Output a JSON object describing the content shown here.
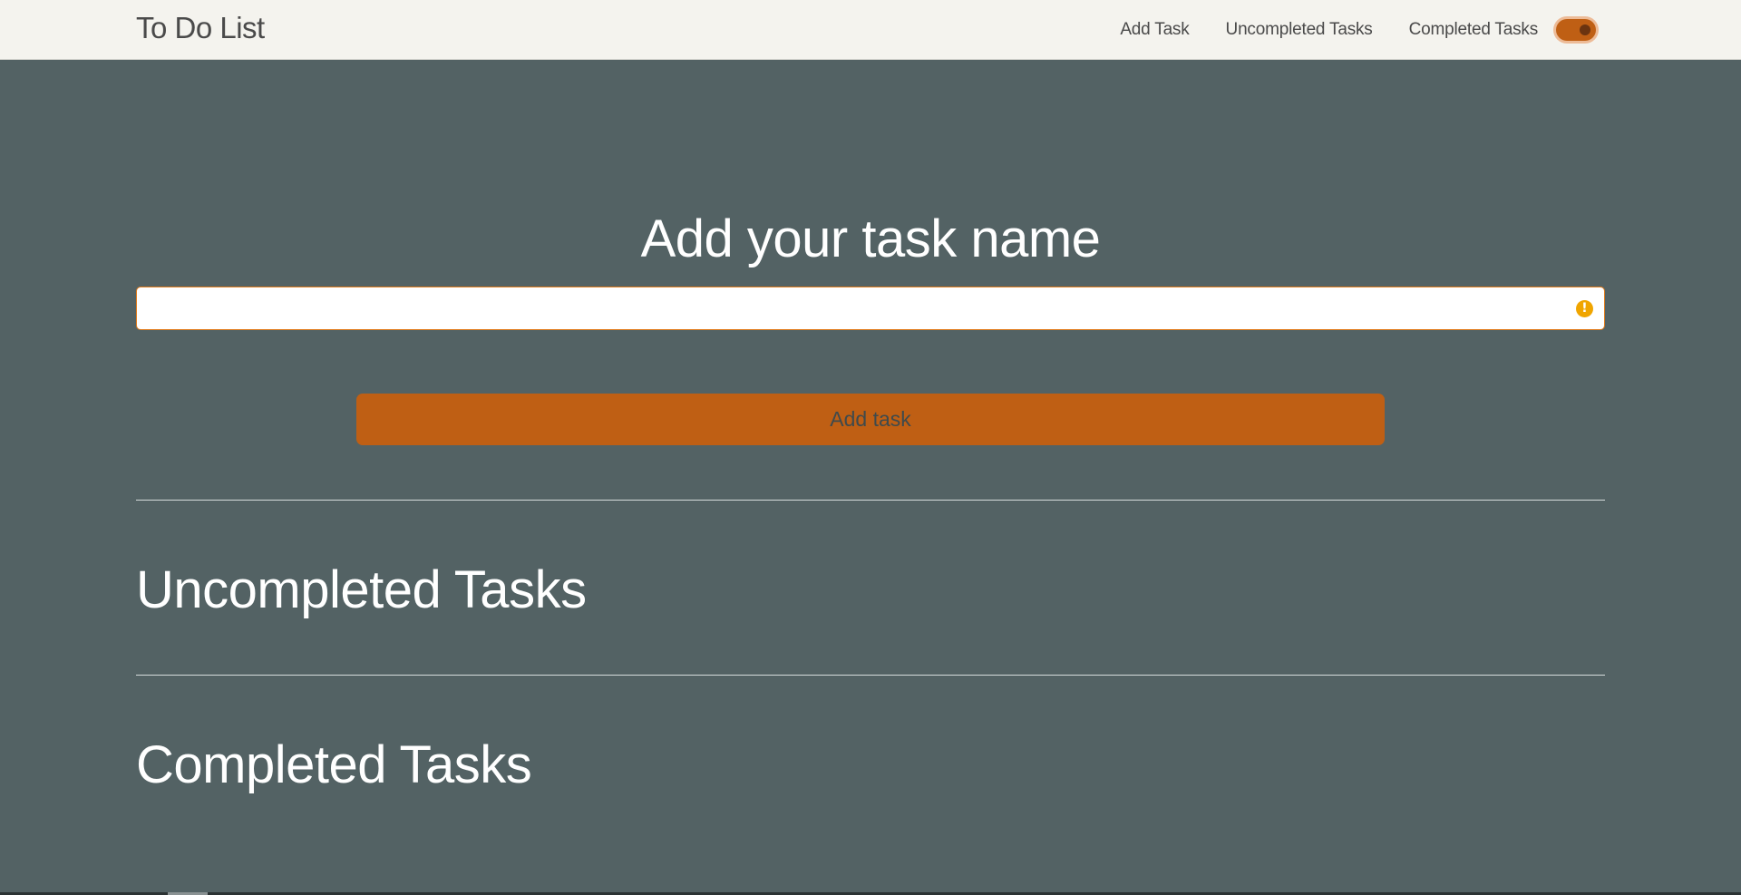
{
  "navbar": {
    "brand": "To Do List",
    "links": [
      {
        "label": "Add Task"
      },
      {
        "label": "Uncompleted Tasks"
      },
      {
        "label": "Completed Tasks"
      }
    ],
    "theme_toggle": {
      "state": "on",
      "color": "#bf5f14"
    }
  },
  "main": {
    "add_heading": "Add your task name",
    "task_input": {
      "value": "",
      "placeholder": "",
      "warning_icon": "exclamation-circle-icon"
    },
    "add_button_label": "Add task"
  },
  "sections": {
    "uncompleted_title": "Uncompleted Tasks",
    "uncompleted_items": [],
    "completed_title": "Completed Tasks",
    "completed_items": []
  },
  "colors": {
    "background": "#536264",
    "navbar": "#f4f3ee",
    "accent": "#bf5f14",
    "warning": "#f0a500"
  }
}
